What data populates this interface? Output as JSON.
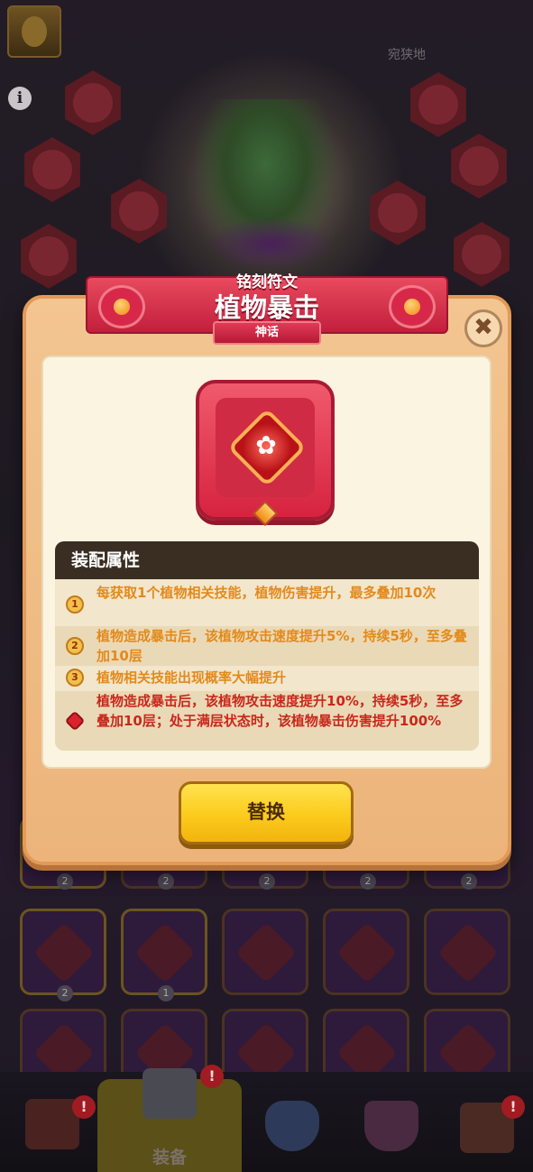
{
  "top_bar": {
    "right_text": "宛狭地"
  },
  "info_icon_glyph": "i",
  "modal": {
    "subtitle": "铭刻符文",
    "title": "植物暴击",
    "rarity": "神话",
    "close_glyph": "✖",
    "rune_icon": "flower-rune-icon",
    "attributes": {
      "header": "装配属性",
      "rows": [
        {
          "index": "1",
          "text": "每获取1个植物相关技能，植物伤害提升，最多叠加10次"
        },
        {
          "index": "2",
          "text": "植物造成暴击后，该植物攻击速度提升5%，持续5秒，至多叠加10层"
        },
        {
          "index": "3",
          "text": "植物相关技能出现概率大幅提升"
        },
        {
          "index": "",
          "text": "植物造成暴击后，该植物攻击速度提升10%，持续5秒，至多叠加10层；处于满层状态时，该植物暴击伤害提升100%"
        }
      ]
    },
    "replace_label": "替换"
  },
  "slots": {
    "row1_badges": [
      "2",
      "2",
      "2",
      "2"
    ],
    "row2_badges": [
      "2",
      "1"
    ]
  },
  "bottom_nav": {
    "alert_glyph": "!",
    "active_label": "装备",
    "tabs": [
      {
        "icon": "shop-icon",
        "has_alert": true
      },
      {
        "icon": "equipment-icon",
        "has_alert": true
      },
      {
        "icon": "shield-icon",
        "has_alert": false
      },
      {
        "icon": "trophy-icon",
        "has_alert": false
      },
      {
        "icon": "chest-icon",
        "has_alert": true
      }
    ]
  },
  "colors": {
    "modal_bg": "#f3c591",
    "ribbon": "#d8284a",
    "button": "#fbcb1c",
    "attr_text": "#e38a1c",
    "attr_text_mythic": "#c8281c"
  }
}
